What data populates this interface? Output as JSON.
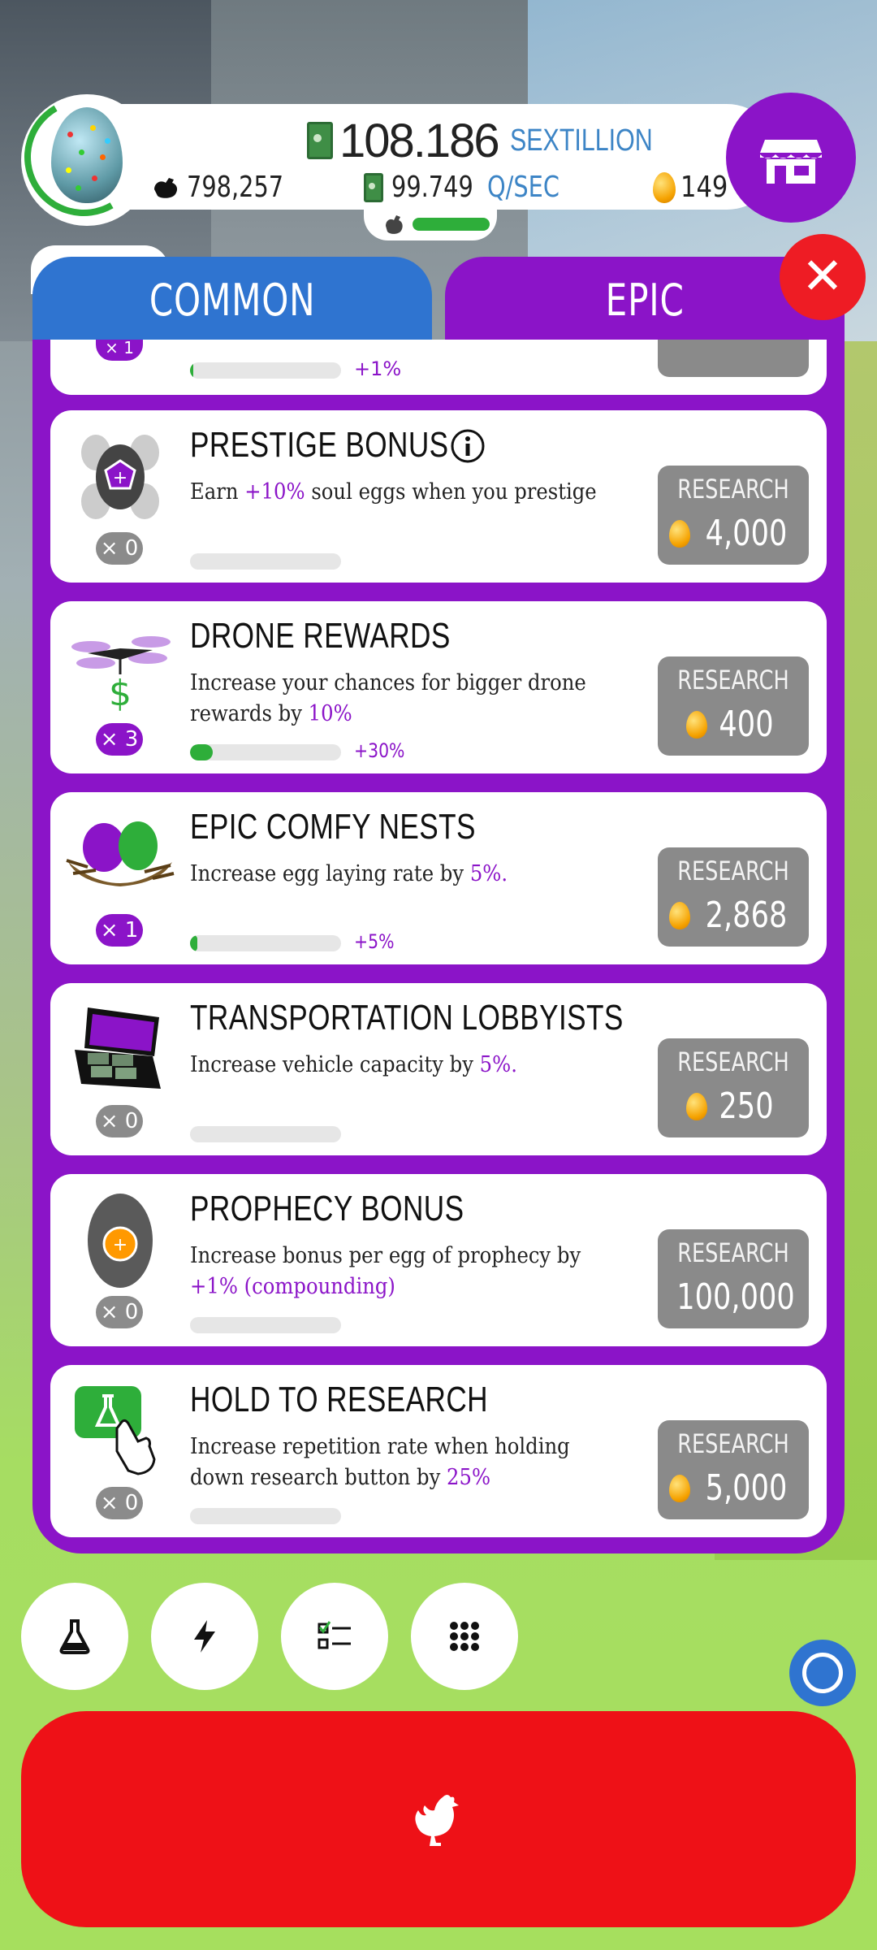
{
  "header": {
    "money_value": "108.186",
    "money_unit": "SEXTILLION",
    "chicken_count": "798,257",
    "rate_value": "99.749",
    "rate_unit": "Q/SEC",
    "golden_eggs": "149",
    "hab_progress": 0.9
  },
  "tabs": {
    "common": "COMMON",
    "epic": "EPIC",
    "active": "EPIC"
  },
  "partial_card": {
    "count": "× 1",
    "bonus": "+1%",
    "progress": 0.02
  },
  "research_button_label": "RESEARCH",
  "cards": [
    {
      "title": "PRESTIGE BONUS",
      "desc_pre": "Earn ",
      "desc_hl": "+10%",
      "desc_post": " soul eggs when you prestige",
      "count": "× 0",
      "bonus": "",
      "progress": 0,
      "cost": "4,000",
      "has_info": true
    },
    {
      "title": "DRONE REWARDS",
      "desc_pre": "Increase your chances for bigger drone rewards by ",
      "desc_hl": "10%",
      "desc_post": "",
      "count": "× 3",
      "bonus": "+30%",
      "progress": 0.15,
      "cost": "400",
      "has_info": false
    },
    {
      "title": "EPIC COMFY NESTS",
      "desc_pre": "Increase egg laying rate by ",
      "desc_hl": "5%.",
      "desc_post": "",
      "count": "× 1",
      "bonus": "+5%",
      "progress": 0.05,
      "cost": "2,868",
      "has_info": false
    },
    {
      "title": "TRANSPORTATION LOBBYISTS",
      "desc_pre": "Increase vehicle capacity by ",
      "desc_hl": "5%.",
      "desc_post": "",
      "count": "× 0",
      "bonus": "",
      "progress": 0,
      "cost": "250",
      "has_info": false
    },
    {
      "title": "PROPHECY BONUS",
      "desc_pre": "Increase bonus per egg of prophecy by ",
      "desc_hl": "+1% (compounding)",
      "desc_post": "",
      "count": "× 0",
      "bonus": "",
      "progress": 0,
      "cost": "100,000",
      "has_info": false
    },
    {
      "title": "HOLD TO RESEARCH",
      "desc_pre": "Increase repetition rate when holding down research button by ",
      "desc_hl": "25%",
      "desc_post": "",
      "count": "× 0",
      "bonus": "",
      "progress": 0,
      "cost": "5,000",
      "has_info": false
    }
  ],
  "bottom_nav": [
    "flask-icon",
    "lightning-icon",
    "checklist-icon",
    "grid-icon"
  ],
  "colors": {
    "purple": "#8b14c8",
    "blue": "#2f74d0",
    "red": "#ee1117",
    "green": "#2eae3a"
  }
}
